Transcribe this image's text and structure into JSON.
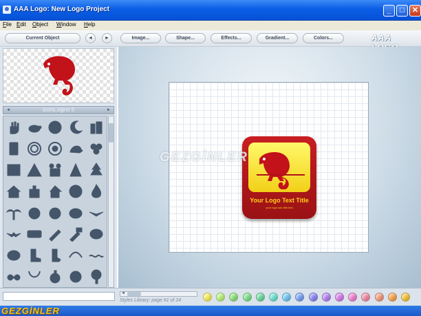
{
  "window": {
    "title": "AAA Logo: New Logo Project",
    "min": "_",
    "max": "□",
    "close": "✕"
  },
  "menu": [
    "File",
    "Edit",
    "Object",
    "Window",
    "Help"
  ],
  "toolbar": {
    "current_object": "Current Object",
    "prev": "◄",
    "next": "►",
    "image": "Image...",
    "shape": "Shape...",
    "effects": "Effects...",
    "gradient": "Gradient...",
    "colors": "Colors...",
    "brand": "AAA LOGO"
  },
  "library": {
    "title": "icons,signs 5",
    "prev": "◄",
    "next": "►",
    "icons": [
      "hand-icon",
      "turtle-icon",
      "globe-icon",
      "moon-icon",
      "building-icon",
      "calculator-icon",
      "spiral-icon",
      "spiral-2-icon",
      "hedgehog-icon",
      "clover-icon",
      "brick-wall-icon",
      "warning-sign-icon",
      "handshake-icon",
      "tree-icon",
      "pine-tree-icon",
      "house-icon",
      "castle-icon",
      "home-icon",
      "snowflake-icon",
      "flame-icon",
      "palm-tree-icon",
      "pig-face-icon",
      "dog-face-icon",
      "cow-face-icon",
      "bird-icon",
      "bird-flying-icon",
      "bus-icon",
      "brush-icon",
      "hammer-icon",
      "elephant-icon",
      "elephant-2-icon",
      "boot-icon",
      "sock-icon",
      "crescent-icon",
      "wave-icon",
      "sunglasses-icon",
      "necklace-icon",
      "bomb-icon",
      "ball-icon",
      "tree-round-icon"
    ]
  },
  "canvas": {
    "logo_title": "Your Logo Text Title",
    "logo_subtitle": "your logo sub-title text",
    "watermark": "GEZGİNLER",
    "tile_color": "#c81e22",
    "inner_color": "#f9e642"
  },
  "bottom": {
    "styles_label": "Styles Library: page #1 of 24",
    "swatch_colors": [
      "#f6ec5a",
      "#b9ef7c",
      "#8fe07a",
      "#7ee08a",
      "#6fd7a0",
      "#6ee0cf",
      "#6fc7ee",
      "#7aa0f0",
      "#8a86f0",
      "#b382ee",
      "#d67be6",
      "#ee7fcd",
      "#f08aa4",
      "#f09a7c",
      "#f5a24e",
      "#f2c23e"
    ]
  },
  "taskbar": {
    "logo": "GEZGİNLER"
  }
}
